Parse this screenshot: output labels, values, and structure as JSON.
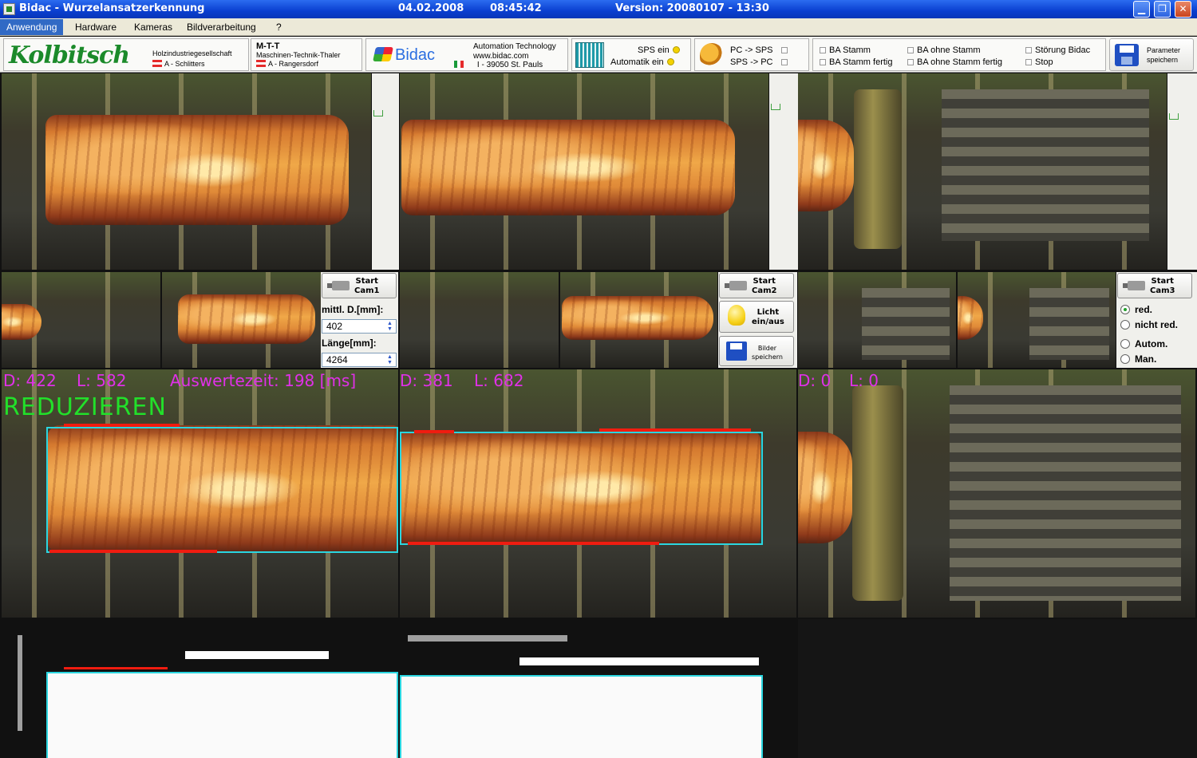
{
  "window": {
    "title": "Bidac - Wurzelansatzerkennung",
    "date": "04.02.2008",
    "time": "08:45:42",
    "version": "Version: 20080107 - 13:30",
    "controls": [
      "minimize",
      "maximize",
      "close"
    ]
  },
  "menu": {
    "items": [
      {
        "label": "Anwendung",
        "active": true
      },
      {
        "label": "Hardware",
        "active": false
      },
      {
        "label": "Kameras",
        "active": false
      },
      {
        "label": "Bildverarbeitung",
        "active": false
      },
      {
        "label": "?",
        "active": false
      }
    ]
  },
  "header": {
    "kolbitsch": {
      "logo": "Kolbitsch",
      "line1": "Holzindustriegesellschaft",
      "line2": "A - Schlitters"
    },
    "mtt": {
      "line1": "M-T-T",
      "line2": "Maschinen-Technik-Thaler",
      "line3": "A - Rangersdorf"
    },
    "bidac": {
      "logo": "Bidac",
      "line1": "Automation Technology",
      "line2": "www.bidac.com",
      "line3": "I - 39050 St. Pauls"
    },
    "sps": {
      "sps_ein": "SPS ein",
      "automatik_ein": "Automatik ein"
    },
    "comm": {
      "pc_to_sps": "PC -> SPS",
      "sps_to_pc": "SPS -> PC"
    },
    "status": {
      "ba_stamm": "BA Stamm",
      "ba_ohne_stamm": "BA ohne Stamm",
      "stoerung": "Störung Bidac",
      "ba_stamm_fertig": "BA Stamm fertig",
      "ba_ohne_stamm_fertig": "BA ohne Stamm fertig",
      "stop": "Stop"
    },
    "params_button": {
      "line1": "Parameter",
      "line2": "speichern"
    }
  },
  "controls": {
    "cam1": {
      "start_button": "Start\nCam1",
      "diam_label": "mittl. D.[mm]:",
      "diam_value": "402",
      "length_label": "Länge[mm]:",
      "length_value": "4264"
    },
    "cam2": {
      "start_button": "Start\nCam2",
      "light_button": "Licht\nein/aus",
      "save_images_button": "Bilder\nspeichern"
    },
    "cam3": {
      "start_button": "Start\nCam3",
      "radio_red": "red.",
      "radio_nicht_red": "nicht red.",
      "radio_autom": "Autom.",
      "radio_man": "Man."
    }
  },
  "analysis": {
    "cam1": {
      "d": "D: 422",
      "l": "L: 582",
      "time": "Auswertezeit: 198 [ms]",
      "decision": "REDUZIEREN"
    },
    "cam2": {
      "d": "D: 381",
      "l": "L: 682"
    },
    "cam3": {
      "d": "D: 0",
      "l": "L: 0"
    }
  },
  "colors": {
    "overlay_text": "#e030e8",
    "decision": "#22e02a",
    "bbox": "#2ad6e0",
    "defect_line": "#f01c10"
  }
}
